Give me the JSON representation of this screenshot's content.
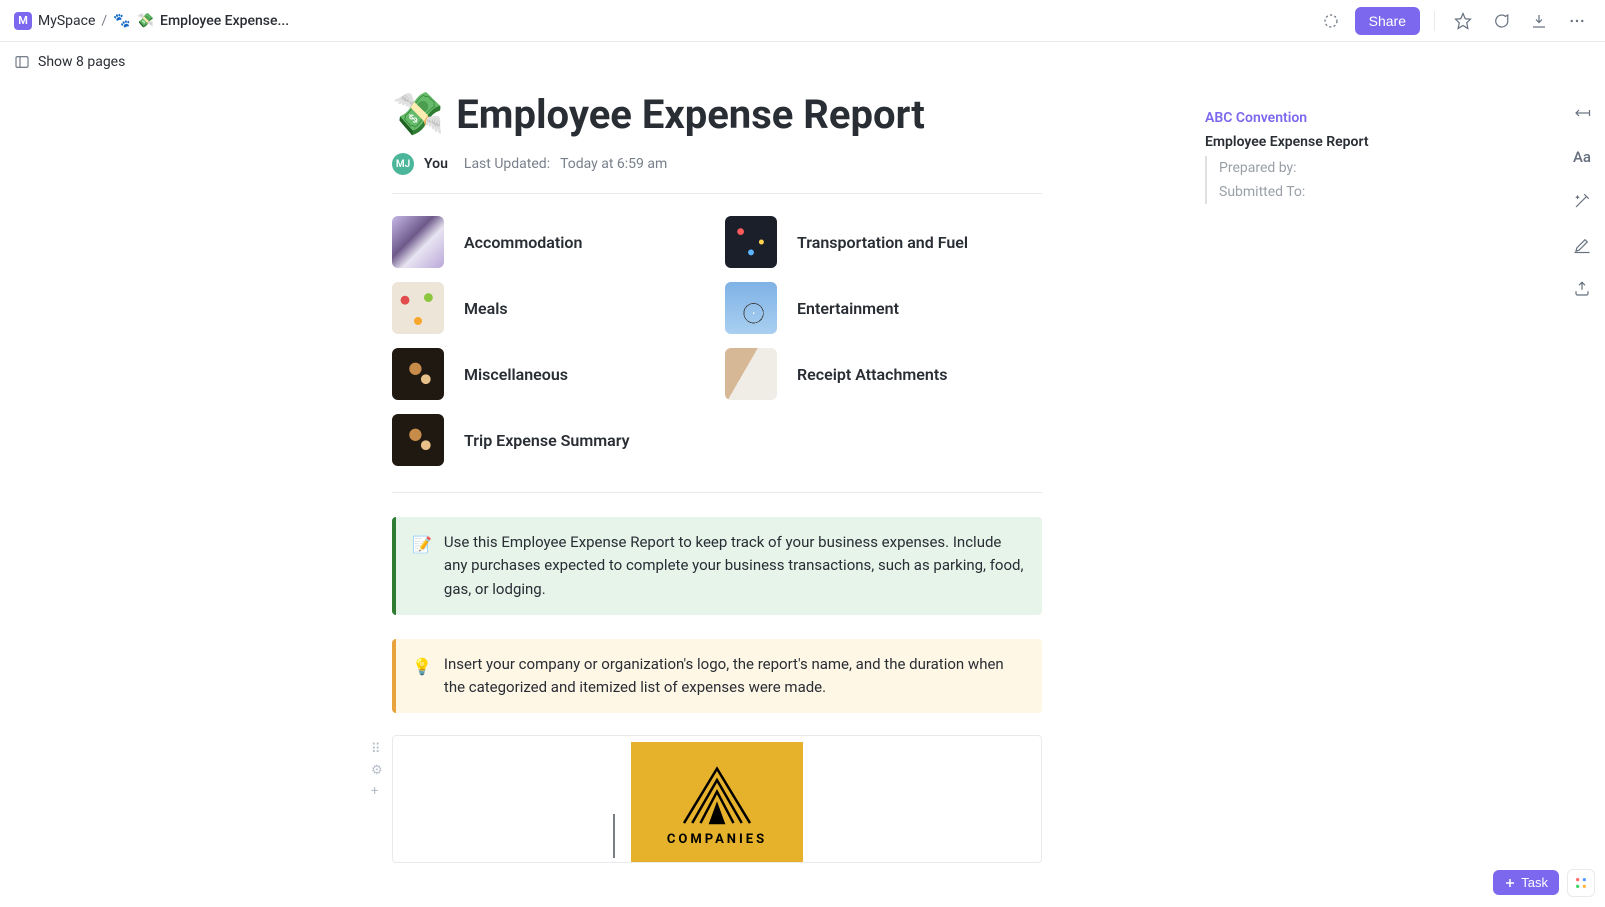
{
  "breadcrumb": {
    "space": "MySpace",
    "sep": "/",
    "page": "Employee Expense..."
  },
  "topbar": {
    "share": "Share"
  },
  "showpages": "Show 8 pages",
  "title": {
    "emoji": "💸",
    "text": "Employee Expense Report"
  },
  "meta": {
    "avatar": "MJ",
    "you": "You",
    "updated_label": "Last Updated:",
    "updated_val": "Today at 6:59 am"
  },
  "categories": [
    {
      "label": "Accommodation",
      "thumb": "th-room"
    },
    {
      "label": "Transportation and Fuel",
      "thumb": "th-traffic"
    },
    {
      "label": "Meals",
      "thumb": "th-food"
    },
    {
      "label": "Entertainment",
      "thumb": "th-wheel"
    },
    {
      "label": "Miscellaneous",
      "thumb": "th-dark"
    },
    {
      "label": "Receipt Attachments",
      "thumb": "th-receipt"
    },
    {
      "label": "Trip Expense Summary",
      "thumb": "th-dark"
    }
  ],
  "callouts": {
    "green": {
      "emoji": "📝",
      "text": "Use this Employee Expense Report to keep track of your business expenses. Include any purchases expected to complete your business transactions, such as parking, food, gas, or lodging."
    },
    "yellow": {
      "emoji": "💡",
      "text": "Insert your company or organization's logo, the report's name, and the duration when the categorized and itemized list of expenses were made."
    }
  },
  "logo": {
    "text": "COMPANIES"
  },
  "outline": {
    "l1": "ABC Convention",
    "l2": "Employee Expense Report",
    "l3a": "Prepared by:",
    "l3b": "Submitted To:"
  },
  "taskbtn": "Task"
}
